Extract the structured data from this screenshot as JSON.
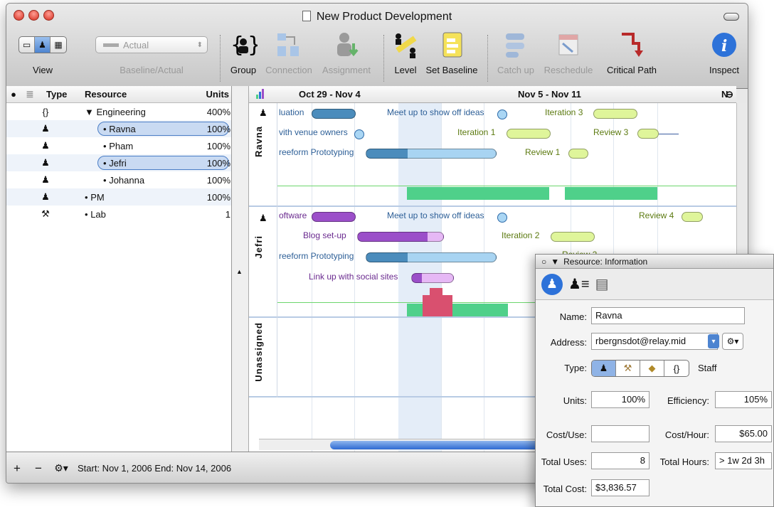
{
  "window": {
    "title": "New Product Development"
  },
  "toolbar": {
    "view_label": "View",
    "baseline_value": "Actual",
    "baseline_label": "Baseline/Actual",
    "group_label": "Group",
    "connection_label": "Connection",
    "assignment_label": "Assignment",
    "level_label": "Level",
    "set_baseline_label": "Set Baseline",
    "catchup_label": "Catch up",
    "reschedule_label": "Reschedule",
    "critical_path_label": "Critical Path",
    "inspect_label": "Inspect"
  },
  "outline": {
    "headers": {
      "type": "Type",
      "resource": "Resource",
      "units": "Units"
    },
    "rows": [
      {
        "type": "{}",
        "name": "Engineering",
        "units": "400%",
        "prefix": "▼"
      },
      {
        "type": "♟",
        "name": "Ravna",
        "units": "100%",
        "prefix": "•"
      },
      {
        "type": "♟",
        "name": "Pham",
        "units": "100%",
        "prefix": "•"
      },
      {
        "type": "♟",
        "name": "Jefri",
        "units": "100%",
        "prefix": "•"
      },
      {
        "type": "♟",
        "name": "Johanna",
        "units": "100%",
        "prefix": "•"
      },
      {
        "type": "♟",
        "name": "PM",
        "units": "100%",
        "prefix": "•"
      },
      {
        "type": "⚒",
        "name": "Lab",
        "units": "1",
        "prefix": "•"
      }
    ]
  },
  "gantt": {
    "weeks": [
      "Oct 29 - Nov 4",
      "Nov 5 - Nov 11",
      "N"
    ],
    "lanes": [
      "Ravna",
      "Jefri",
      "Unassigned"
    ],
    "ravna_tasks": [
      "luation",
      "vith venue owners",
      "reeform Prototyping",
      "Meet up to show off ideas",
      "Iteration 3",
      "Iteration 1",
      "Review 3",
      "Review 1"
    ],
    "jefri_tasks": [
      "oftware",
      "Blog set-up",
      "reeform Prototyping",
      "Link up with social sites",
      "Meet up to show off ideas",
      "Review 4",
      "Iteration 2",
      "Review 2"
    ]
  },
  "status": {
    "text": "Start: Nov 1, 2006 End: Nov 14, 2006"
  },
  "inspector": {
    "title": "Resource: Information",
    "name_label": "Name:",
    "name_value": "Ravna",
    "address_label": "Address:",
    "address_value": "rbergnsdot@relay.mid",
    "type_label": "Type:",
    "type_value": "Staff",
    "units_label": "Units:",
    "units_value": "100%",
    "efficiency_label": "Efficiency:",
    "efficiency_value": "105%",
    "cost_use_label": "Cost/Use:",
    "cost_use_value": "",
    "cost_hour_label": "Cost/Hour:",
    "cost_hour_value": "$65.00",
    "total_uses_label": "Total Uses:",
    "total_uses_value": "8",
    "total_hours_label": "Total Hours:",
    "total_hours_value": "> 1w 2d 3h",
    "total_cost_label": "Total Cost:",
    "total_cost_value": "$3,836.57"
  },
  "colors": {
    "accent": "#4d84d0",
    "milestone": "#aad6f4",
    "lime": "#dff59a",
    "purple": "#9b4fc9",
    "green": "#4fd08a",
    "overload": "#d9506f"
  }
}
